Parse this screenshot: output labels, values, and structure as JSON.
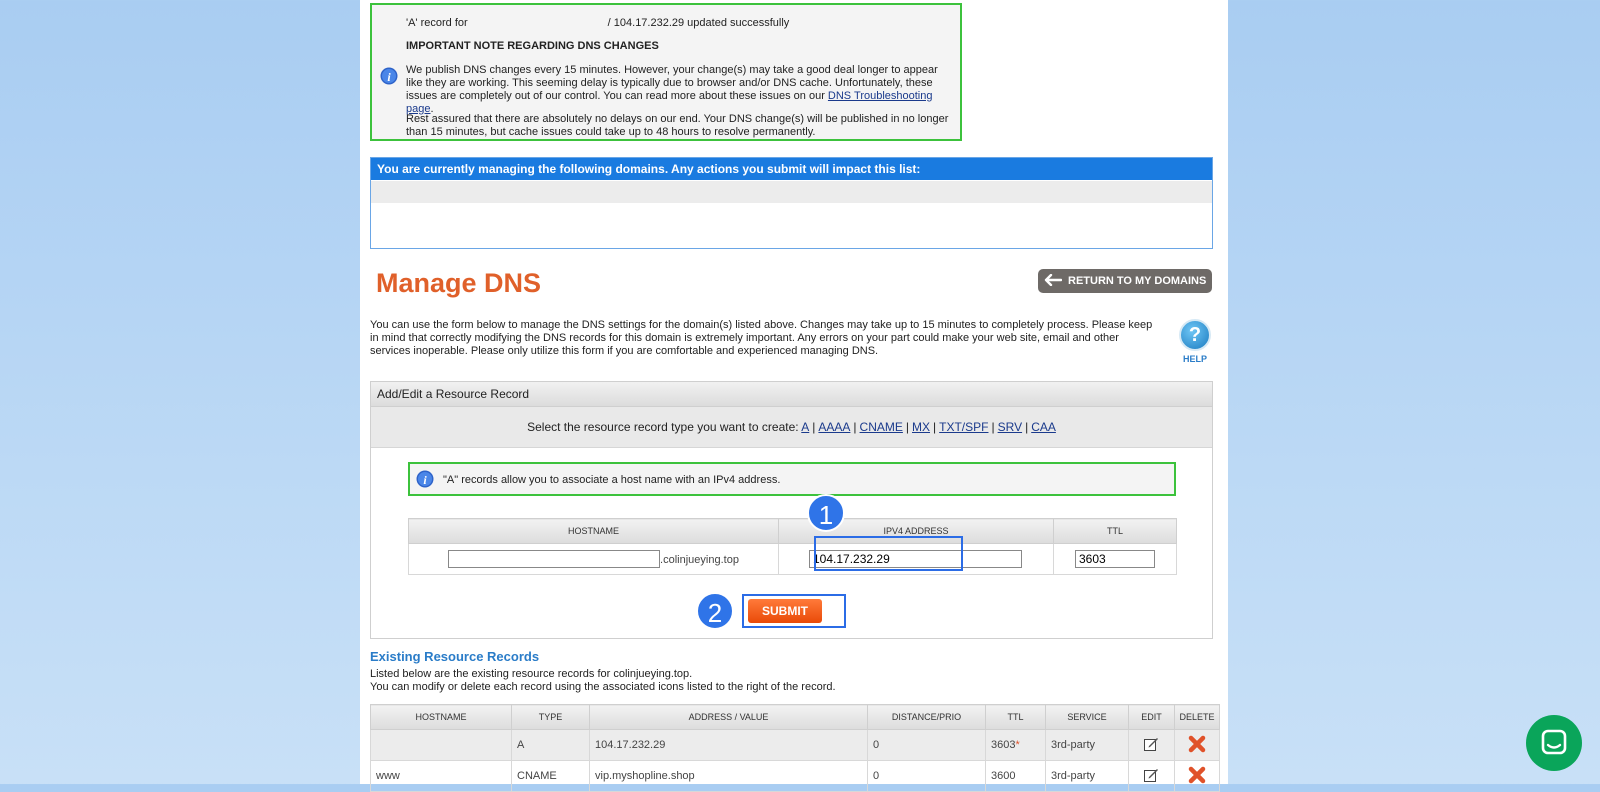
{
  "notice": {
    "record_prefix": "'A' record for",
    "record_suffix": "/ 104.17.232.29 updated successfully",
    "heading": "IMPORTANT NOTE REGARDING DNS CHANGES",
    "para1_text": "We publish DNS changes every 15 minutes. However, your change(s) may take a good deal longer to appear like they are working. This seeming delay is typically due to browser and/or DNS cache. Unfortunately, these issues are completely out of our control. You can read more about these issues on our",
    "para1_link": "DNS Troubleshooting page",
    "para2": "Rest assured that there are absolutely no delays on our end. Your DNS change(s) will be published in no longer than 15 minutes, but cache issues could take up to 48 hours to resolve permanently."
  },
  "managed": {
    "header": "You are currently managing the following domains. Any actions you submit will impact this list:"
  },
  "page_title": "Manage DNS",
  "return_button": "RETURN TO MY DOMAINS",
  "description": "You can use the form below to manage the DNS settings for the domain(s) listed above. Changes may take up to 15 minutes to completely process. Please keep in mind that correctly modifying the DNS records for this domain is extremely important. Any errors on your part could make your web site, email and other services inoperable. Please only utilize this form if you are comfortable and experienced managing DNS.",
  "help_label": "HELP",
  "add_edit": {
    "header": "Add/Edit a Resource Record",
    "select_prompt": "Select the resource record type you want to create:",
    "types": [
      "A",
      "AAAA",
      "CNAME",
      "MX",
      "TXT/SPF",
      "SRV",
      "CAA"
    ],
    "a_note": "\"A\" records allow you to associate a host name with an IPv4 address.",
    "columns": [
      "HOSTNAME",
      "IPV4 ADDRESS",
      "TTL"
    ],
    "hostname_value": "",
    "domain_suffix": ".colinjueying.top",
    "ipv4_value": "104.17.232.29",
    "ttl_value": "3603",
    "submit_label": "SUBMIT"
  },
  "badges": [
    "1",
    "2"
  ],
  "existing": {
    "title": "Existing Resource Records",
    "line1": "Listed below are the existing resource records for colinjueying.top.",
    "line2": "You can modify or delete each record using the associated icons listed to the right of the record.",
    "columns": [
      "HOSTNAME",
      "TYPE",
      "ADDRESS / VALUE",
      "DISTANCE/PRIO",
      "TTL",
      "SERVICE",
      "EDIT",
      "DELETE"
    ],
    "rows": [
      {
        "hostname": "",
        "type": "A",
        "value": "104.17.232.29",
        "prio": "0",
        "ttl": "3603",
        "ttl_mark": "*",
        "service": "3rd-party"
      },
      {
        "hostname": "www",
        "type": "CNAME",
        "value": "vip.myshopline.shop",
        "prio": "0",
        "ttl": "3600",
        "ttl_mark": "",
        "service": "3rd-party"
      }
    ]
  },
  "colors": {
    "accent_orange": "#e0602a",
    "highlight_blue": "#2b6ce6",
    "notice_green": "#3cc23c",
    "header_blue": "#1a7be0",
    "chat_green": "#0aa55a"
  },
  "icons": [
    "info-icon",
    "arrow-left-icon",
    "help-icon",
    "edit-icon",
    "delete-icon",
    "chat-icon"
  ]
}
